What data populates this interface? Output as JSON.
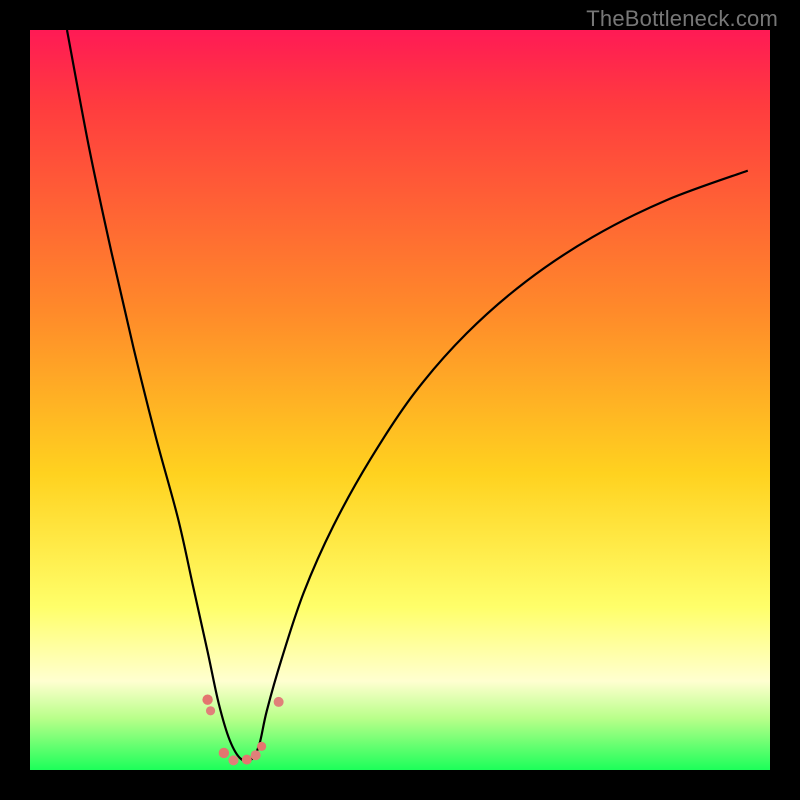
{
  "watermark": "TheBottleneck.com",
  "colors": {
    "frame_bg": "#000000",
    "grad_top": "#ff1a55",
    "grad_upper": "#ff3b3f",
    "grad_mid_upper": "#ff8a2a",
    "grad_mid": "#ffd21f",
    "grad_light": "#ffff6a",
    "grad_pale": "#ffffd0",
    "grad_green_light": "#b9ff8a",
    "grad_green": "#1cff5a",
    "curve_stroke": "#000000",
    "marker_fill": "#e4756f",
    "marker_fill2": "#e08079"
  },
  "chart_data": {
    "type": "line",
    "title": "",
    "xlabel": "",
    "ylabel": "",
    "xlim": [
      0,
      100
    ],
    "ylim": [
      0,
      100
    ],
    "series": [
      {
        "name": "bottleneck-curve",
        "x": [
          5,
          8,
          11,
          14,
          17,
          20,
          22,
          24,
          25.5,
          27,
          28.5,
          30,
          31,
          32,
          34,
          37,
          41,
          46,
          52,
          59,
          67,
          76,
          86,
          97
        ],
        "y": [
          100,
          84,
          70,
          57,
          45,
          34,
          25,
          16,
          9,
          4,
          1.5,
          1.5,
          3.5,
          8,
          15,
          24,
          33,
          42,
          51,
          59,
          66,
          72,
          77,
          81
        ]
      }
    ],
    "markers": [
      {
        "x": 24.0,
        "y": 9.5,
        "r": 5.2
      },
      {
        "x": 24.4,
        "y": 8.0,
        "r": 4.6
      },
      {
        "x": 26.2,
        "y": 2.3,
        "r": 5.2
      },
      {
        "x": 27.5,
        "y": 1.3,
        "r": 5.0
      },
      {
        "x": 29.3,
        "y": 1.4,
        "r": 5.0
      },
      {
        "x": 30.5,
        "y": 2.0,
        "r": 5.0
      },
      {
        "x": 31.3,
        "y": 3.2,
        "r": 4.6
      },
      {
        "x": 33.6,
        "y": 9.2,
        "r": 5.0
      }
    ],
    "grid": false,
    "legend_position": "none"
  }
}
